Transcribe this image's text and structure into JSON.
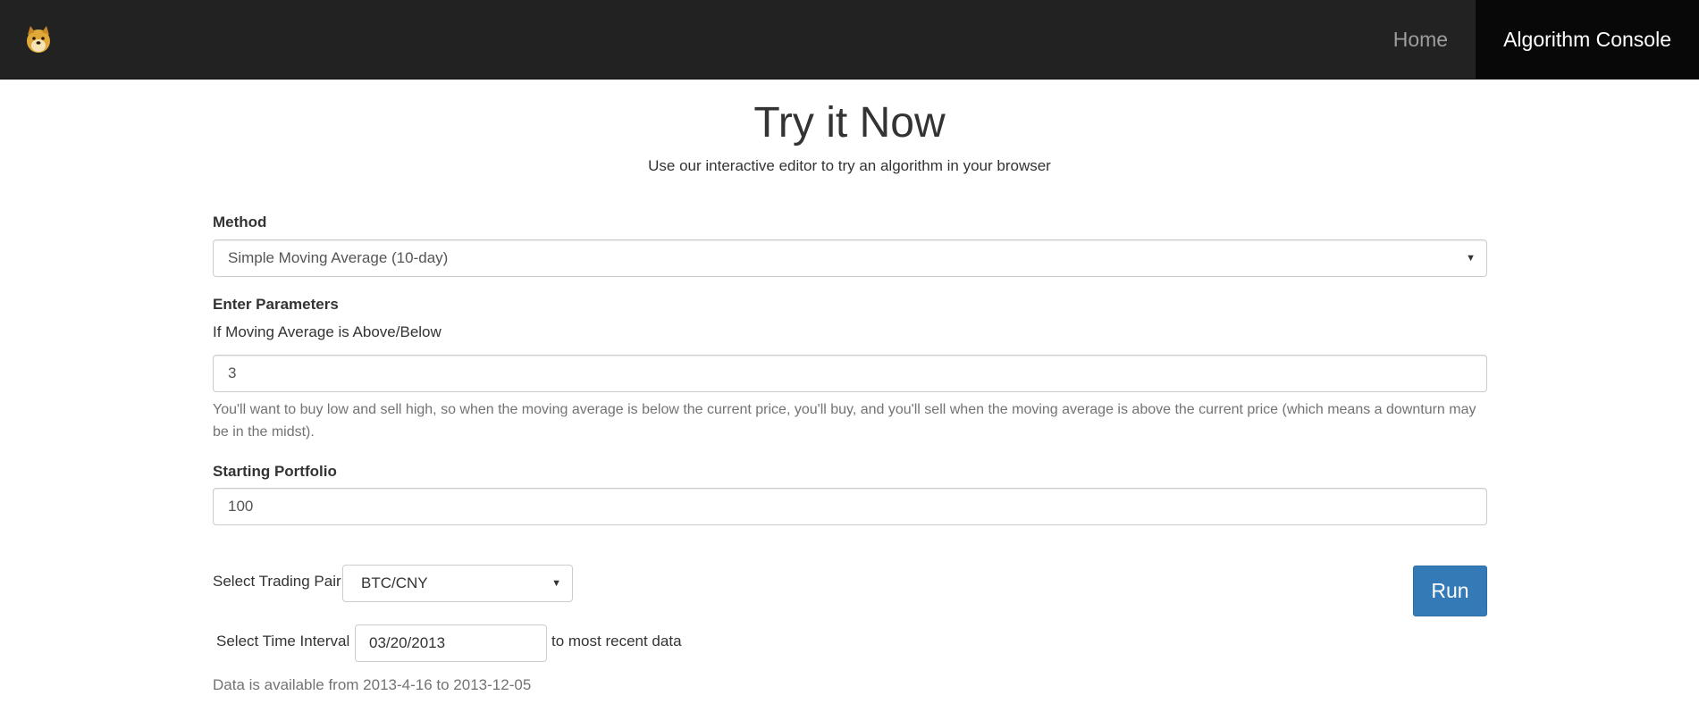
{
  "navbar": {
    "brand_icon": "doge-logo-icon",
    "links": [
      {
        "label": "Home",
        "active": false
      },
      {
        "label": "Algorithm Console",
        "active": true
      }
    ]
  },
  "header": {
    "title": "Try it Now",
    "subtitle": "Use our interactive editor to try an algorithm in your browser"
  },
  "form": {
    "method": {
      "label": "Method",
      "selected": "Simple Moving Average (10-day)"
    },
    "parameters": {
      "label": "Enter Parameters",
      "sublabel": "If Moving Average is Above/Below",
      "value": "3",
      "help": "You'll want to buy low and sell high, so when the moving average is below the current price, you'll buy, and you'll sell when the moving average is above the current price (which means a downturn may be in the midst)."
    },
    "portfolio": {
      "label": "Starting Portfolio",
      "value": "100"
    },
    "trading_pair": {
      "label": "Select Trading Pair",
      "selected": "BTC/CNY"
    },
    "time_interval": {
      "label": "Select Time Interval",
      "value": "03/20/2013",
      "suffix": "to most recent data"
    },
    "availability": "Data is available from 2013-4-16 to 2013-12-05",
    "run_label": "Run"
  },
  "colors": {
    "navbar_bg": "#222222",
    "nav_active_bg": "#080808",
    "primary": "#337ab7"
  }
}
